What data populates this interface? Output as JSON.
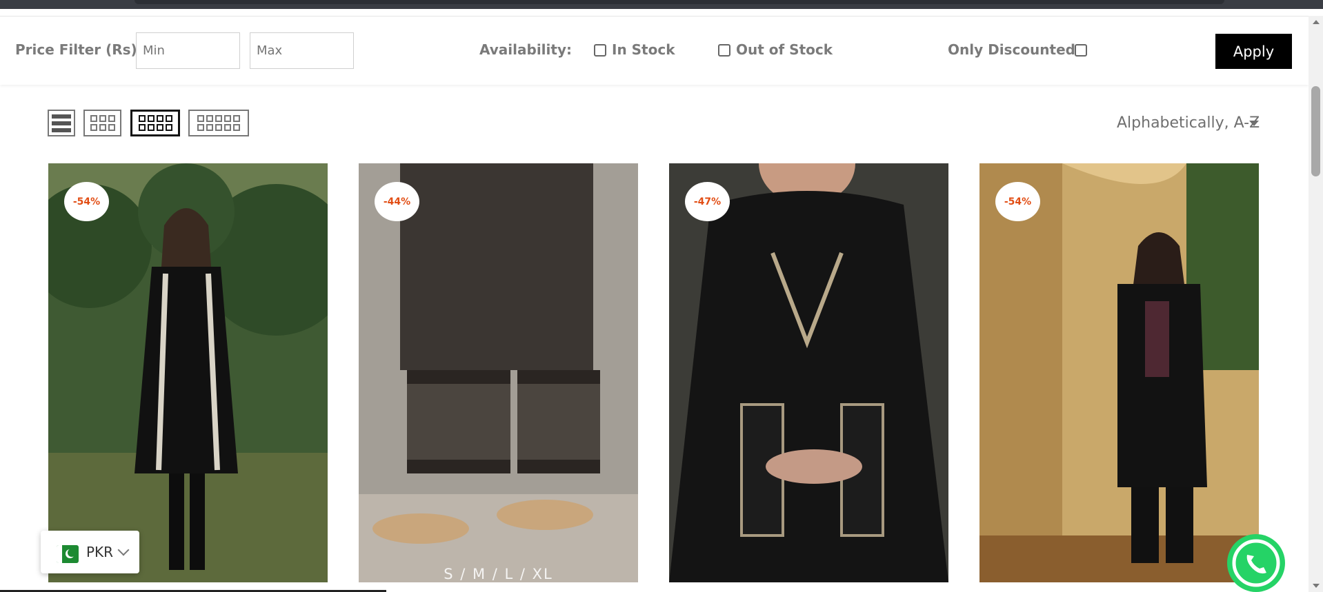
{
  "filters": {
    "price_label": "Price Filter (Rs):",
    "min_placeholder": "Min",
    "max_placeholder": "Max",
    "availability_label": "Availability:",
    "in_stock_label": "In Stock",
    "out_of_stock_label": "Out of Stock",
    "discounted_label": "Only Discounted:",
    "apply_label": "Apply"
  },
  "view_options": [
    "list",
    "3-column",
    "4-column",
    "5-column"
  ],
  "active_view": "4-column",
  "sort": {
    "selected": "Alphabetically, A-Z"
  },
  "products": [
    {
      "discount": "-54%",
      "size_text": ""
    },
    {
      "discount": "-44%",
      "size_text": "S / M / L / XL"
    },
    {
      "discount": "-47%",
      "size_text": ""
    },
    {
      "discount": "-54%",
      "size_text": ""
    }
  ],
  "currency": {
    "code": "PKR",
    "flag_icon": "pakistan-flag-icon"
  },
  "colors": {
    "accent_black": "#000000",
    "badge_text": "#e24e15",
    "whatsapp_green": "#25d366"
  }
}
